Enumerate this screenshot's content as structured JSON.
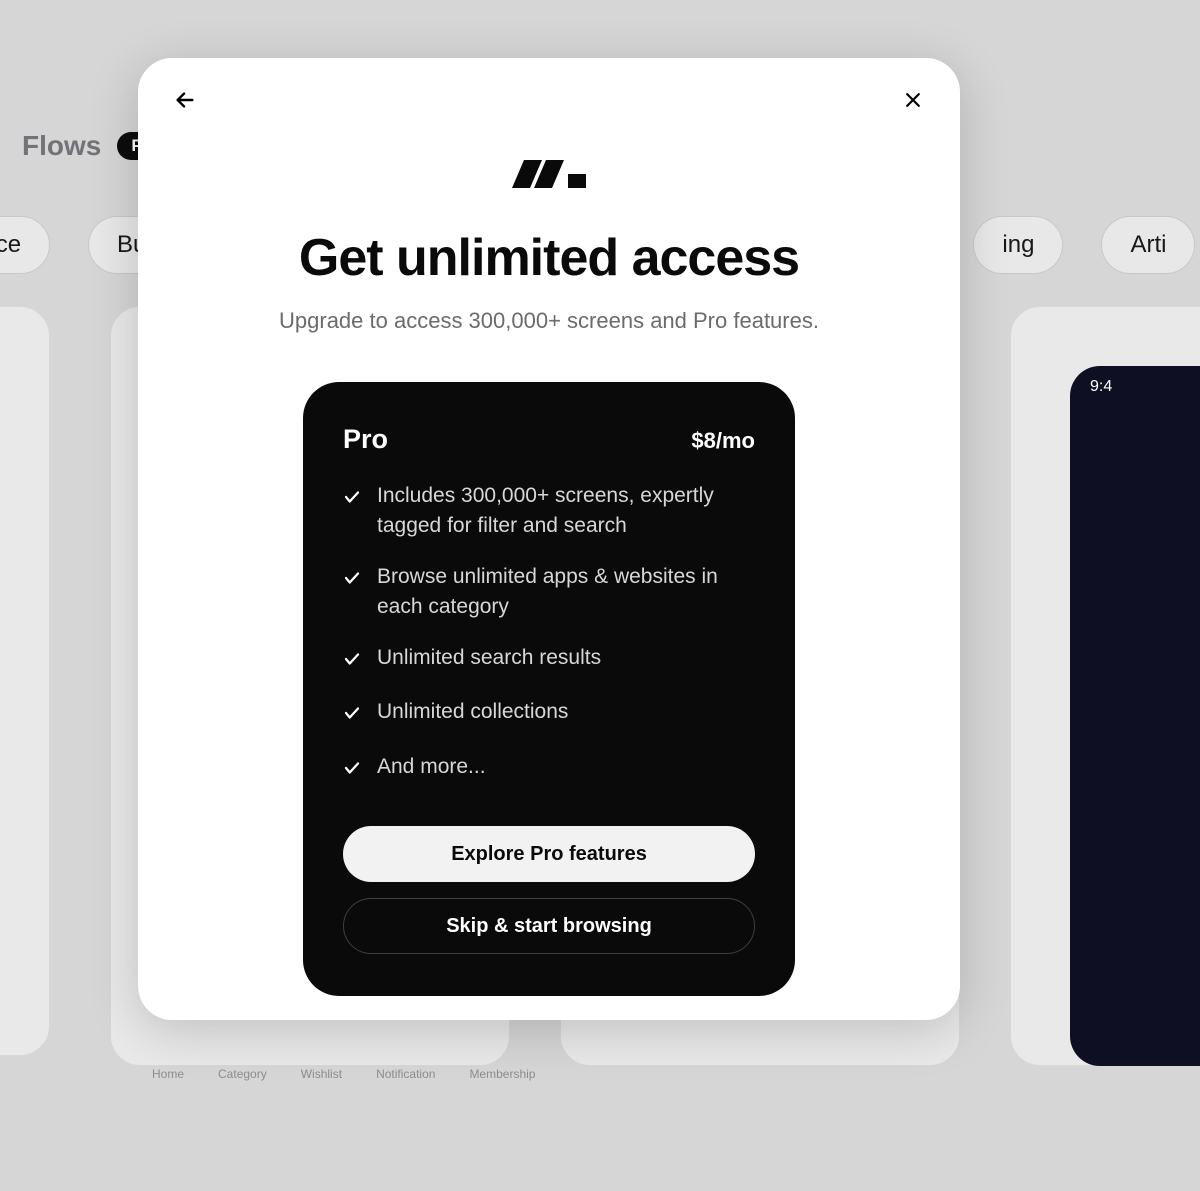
{
  "background": {
    "nav_title": "Flows",
    "nav_badge_fragment": "PF",
    "chips": [
      "ance",
      "Bu",
      "ing",
      "Arti"
    ],
    "timecode": "9:4"
  },
  "modal": {
    "title": "Get unlimited access",
    "subtitle": "Upgrade to access 300,000+ screens and Pro features.",
    "plan": {
      "name": "Pro",
      "price": "$8/mo",
      "features": [
        "Includes 300,000+ screens, expertly tagged for filter and search",
        "Browse unlimited apps & websites in each category",
        "Unlimited search results",
        "Unlimited collections",
        "And more..."
      ],
      "cta_primary": "Explore Pro features",
      "cta_secondary": "Skip & start browsing"
    }
  },
  "peek_nav": [
    "Home",
    "Category",
    "Wishlist",
    "Notification",
    "Membership"
  ]
}
